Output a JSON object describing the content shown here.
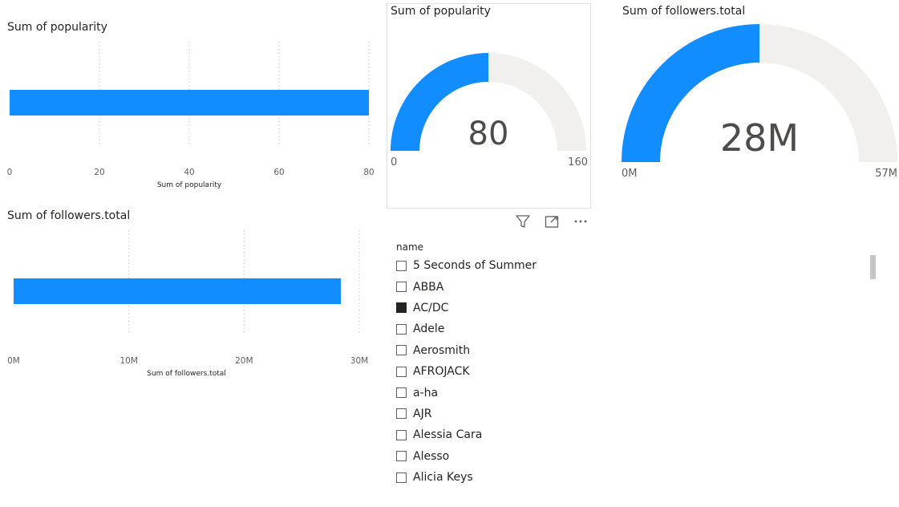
{
  "colors": {
    "accent": "#118DFF",
    "track": "#F1F0EF",
    "grid": "#C8C6C4",
    "text": "#252423"
  },
  "chart_data": [
    {
      "id": "bar_popularity",
      "type": "bar",
      "orientation": "horizontal",
      "title": "Sum of popularity",
      "xlabel": "Sum of popularity",
      "ylabel": "",
      "categories": [
        ""
      ],
      "values": [
        80
      ],
      "xlim": [
        0,
        80
      ],
      "ticks": [
        0,
        20,
        40,
        60,
        80
      ],
      "tick_labels": [
        "0",
        "20",
        "40",
        "60",
        "80"
      ],
      "grid": true
    },
    {
      "id": "gauge_popularity",
      "type": "gauge",
      "title": "Sum of popularity",
      "value": 80,
      "value_label": "80",
      "min": 0,
      "max": 160,
      "min_label": "0",
      "max_label": "160"
    },
    {
      "id": "gauge_followers",
      "type": "gauge",
      "title": "Sum of followers.total",
      "value": 28400000,
      "value_label": "28M",
      "min": 0,
      "max": 56800000,
      "min_label": "0M",
      "max_label": "57M"
    },
    {
      "id": "bar_followers",
      "type": "bar",
      "orientation": "horizontal",
      "title": "Sum of followers.total",
      "xlabel": "Sum of followers.total",
      "ylabel": "",
      "categories": [
        ""
      ],
      "values": [
        28400000
      ],
      "xlim": [
        0,
        30000000
      ],
      "ticks": [
        0,
        10000000,
        20000000,
        30000000
      ],
      "tick_labels": [
        "0M",
        "10M",
        "20M",
        "30M"
      ],
      "grid": true
    }
  ],
  "header_icons": [
    "filter-icon",
    "focus-mode-icon",
    "more-options-icon"
  ],
  "slicer": {
    "title": "name",
    "items": [
      {
        "label": "5 Seconds of Summer",
        "checked": false
      },
      {
        "label": "ABBA",
        "checked": false
      },
      {
        "label": "AC/DC",
        "checked": true
      },
      {
        "label": "Adele",
        "checked": false
      },
      {
        "label": "Aerosmith",
        "checked": false
      },
      {
        "label": "AFROJACK",
        "checked": false
      },
      {
        "label": "a-ha",
        "checked": false
      },
      {
        "label": "AJR",
        "checked": false
      },
      {
        "label": "Alessia Cara",
        "checked": false
      },
      {
        "label": "Alesso",
        "checked": false
      },
      {
        "label": "Alicia Keys",
        "checked": false
      }
    ]
  }
}
